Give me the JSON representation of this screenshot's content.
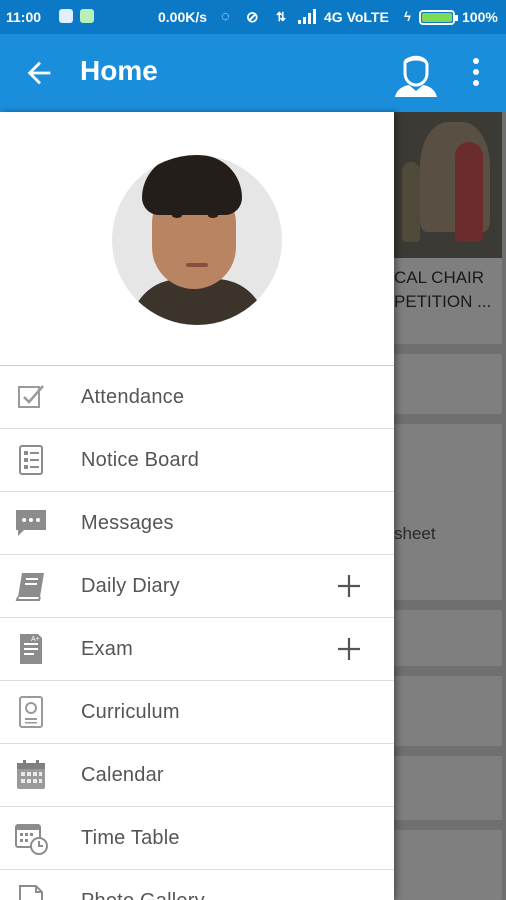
{
  "status_bar": {
    "time": "11:00",
    "speed": "0.00K/s",
    "network": "4G VoLTE",
    "battery_percent_text": "100%",
    "battery_level": 1.0
  },
  "app_bar": {
    "title": "Home",
    "back_icon": "arrow-left-icon",
    "profile_icon": "user-profile-icon",
    "menu_icon": "more-vert-icon"
  },
  "background": {
    "card_caption_line1": "CAL CHAIR",
    "card_caption_line2": "PETITION ...",
    "card3_text": "sheet"
  },
  "drawer": {
    "items": [
      {
        "label": "Attendance",
        "icon": "checkbox-icon",
        "expandable": false
      },
      {
        "label": "Notice Board",
        "icon": "checklist-icon",
        "expandable": false
      },
      {
        "label": "Messages",
        "icon": "chat-bubble-icon",
        "expandable": false
      },
      {
        "label": "Daily Diary",
        "icon": "book-icon",
        "expandable": true
      },
      {
        "label": "Exam",
        "icon": "exam-sheet-icon",
        "expandable": true
      },
      {
        "label": "Curriculum",
        "icon": "certificate-icon",
        "expandable": false
      },
      {
        "label": "Calendar",
        "icon": "calendar-icon",
        "expandable": false
      },
      {
        "label": "Time Table",
        "icon": "calendar-clock-icon",
        "expandable": false
      },
      {
        "label": "Photo Gallery",
        "icon": "photo-document-icon",
        "expandable": false
      }
    ]
  },
  "colors": {
    "status_bar": "#0b79c6",
    "app_bar": "#1a8ddb",
    "scrim": "#6f6f6f",
    "drawer_text": "#555555",
    "icon": "#8c8c8c"
  }
}
